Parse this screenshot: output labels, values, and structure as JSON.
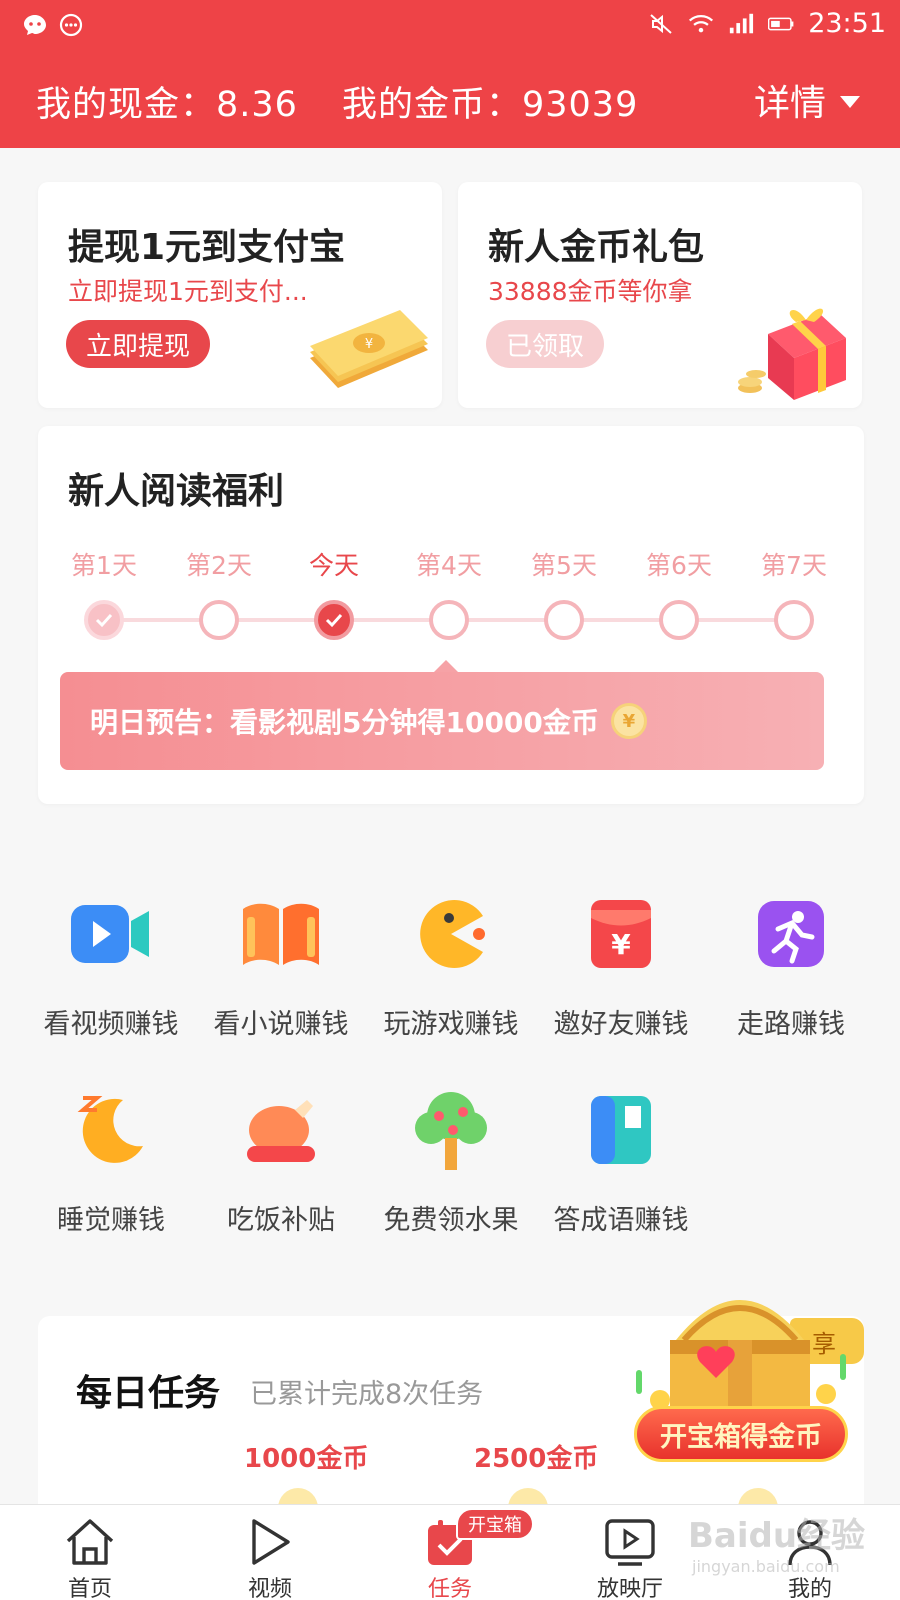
{
  "status_bar": {
    "time": "23:51"
  },
  "header": {
    "cash_text": "我的现金：8.36",
    "coins_text": "我的金币：93039",
    "details_label": "详情"
  },
  "promos": [
    {
      "title": "提现1元到支付宝",
      "subtitle": "立即提现1元到支付...",
      "button": "立即提现"
    },
    {
      "title": "新人金币礼包",
      "subtitle": "33888金币等你拿",
      "button": "已领取"
    }
  ],
  "reading": {
    "title": "新人阅读福利",
    "days": [
      {
        "label": "第1天",
        "state": "done"
      },
      {
        "label": "第2天",
        "state": "pending"
      },
      {
        "label": "今天",
        "state": "today"
      },
      {
        "label": "第4天",
        "state": "pending"
      },
      {
        "label": "第5天",
        "state": "pending"
      },
      {
        "label": "第6天",
        "state": "pending"
      },
      {
        "label": "第7天",
        "state": "pending"
      }
    ],
    "preview_text": "明日预告：看影视剧5分钟得10000金币",
    "coin_glyph": "¥"
  },
  "earn_grid": [
    {
      "label": "看视频赚钱",
      "icon": "video-camera-icon"
    },
    {
      "label": "看小说赚钱",
      "icon": "book-icon"
    },
    {
      "label": "玩游戏赚钱",
      "icon": "pacman-icon"
    },
    {
      "label": "邀好友赚钱",
      "icon": "red-envelope-icon"
    },
    {
      "label": "走路赚钱",
      "icon": "running-icon"
    },
    {
      "label": "睡觉赚钱",
      "icon": "moon-icon"
    },
    {
      "label": "吃饭补贴",
      "icon": "roast-chicken-icon"
    },
    {
      "label": "免费领水果",
      "icon": "fruit-tree-icon"
    },
    {
      "label": "答成语赚钱",
      "icon": "idiom-card-icon"
    }
  ],
  "daily_tasks": {
    "title": "每日任务",
    "subtitle": "已累计完成8次任务",
    "rewards": [
      "1000金币",
      "2500金币"
    ]
  },
  "treasure": {
    "button": "开宝箱得金币",
    "tag": "享"
  },
  "tabbar": {
    "items": [
      {
        "label": "首页",
        "icon": "home-icon"
      },
      {
        "label": "视频",
        "icon": "play-icon"
      },
      {
        "label": "任务",
        "icon": "task-check-icon",
        "active": true
      },
      {
        "label": "放映厅",
        "icon": "screen-play-icon"
      },
      {
        "label": "我的",
        "icon": "user-icon"
      }
    ],
    "badge": "开宝箱"
  },
  "watermark": {
    "main": "Baidu经验",
    "sub": "jingyan.baidu.com"
  },
  "colors": {
    "primary": "#ee4347",
    "accent_red": "#e8474b",
    "pink": "#f5b5ba"
  }
}
